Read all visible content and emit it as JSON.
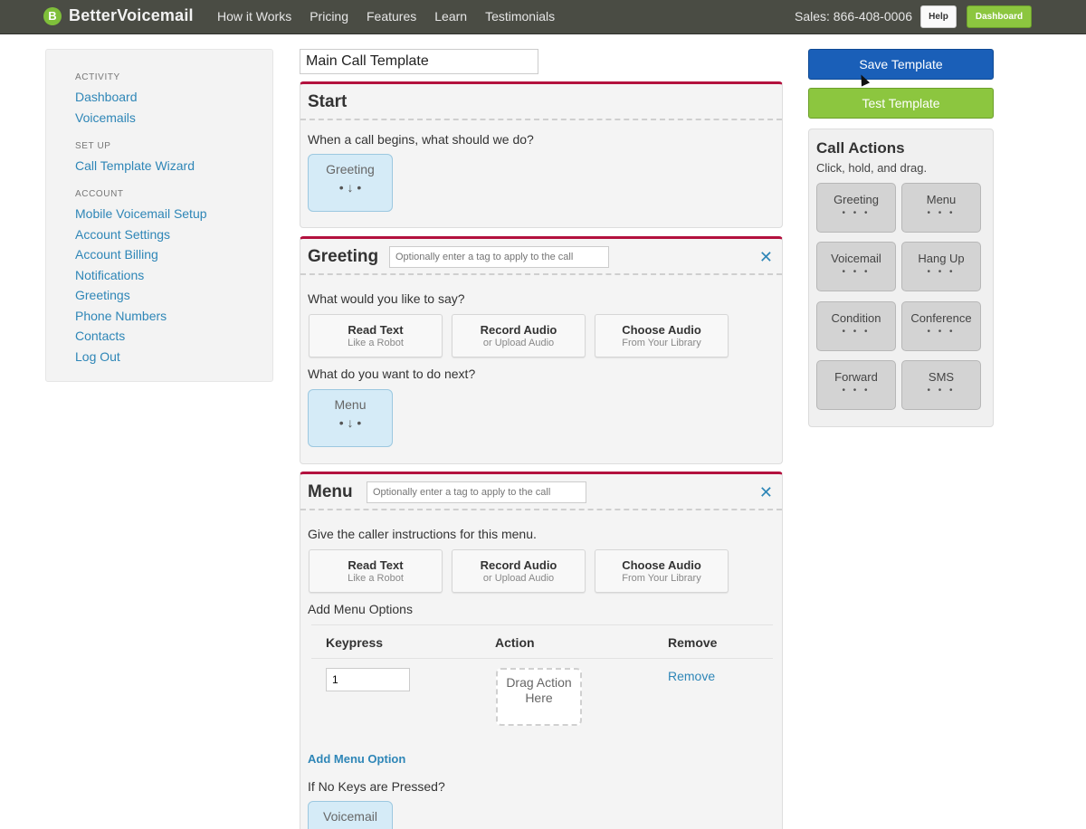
{
  "header": {
    "logo_glyph": "B",
    "brand": "BetterVoicemail",
    "nav": [
      "How it Works",
      "Pricing",
      "Features",
      "Learn",
      "Testimonials"
    ],
    "sales": "Sales: 866-408-0006",
    "help_label": "Help",
    "dashboard_label": "Dashboard"
  },
  "sidebar": {
    "sections": [
      {
        "heading": "ACTIVITY",
        "links": [
          "Dashboard",
          "Voicemails"
        ]
      },
      {
        "heading": "SET UP",
        "links": [
          "Call Template Wizard"
        ]
      },
      {
        "heading": "ACCOUNT",
        "links": [
          "Mobile Voicemail Setup",
          "Account Settings",
          "Account Billing",
          "Notifications",
          "Greetings",
          "Phone Numbers",
          "Contacts",
          "Log Out"
        ]
      }
    ]
  },
  "template_name": "Main Call Template",
  "start": {
    "title": "Start",
    "question": "When a call begins, what should we do?",
    "tile": "Greeting"
  },
  "greeting": {
    "title": "Greeting",
    "tag_placeholder": "Optionally enter a tag to apply to the call",
    "question": "What would you like to say?",
    "options": [
      {
        "title": "Read Text",
        "sub": "Like a Robot"
      },
      {
        "title": "Record Audio",
        "sub": "or Upload Audio"
      },
      {
        "title": "Choose Audio",
        "sub": "From Your Library"
      }
    ],
    "next_question": "What do you want to do next?",
    "next_tile": "Menu"
  },
  "menu": {
    "title": "Menu",
    "tag_placeholder": "Optionally enter a tag to apply to the call",
    "question": "Give the caller instructions for this menu.",
    "options": [
      {
        "title": "Read Text",
        "sub": "Like a Robot"
      },
      {
        "title": "Record Audio",
        "sub": "or Upload Audio"
      },
      {
        "title": "Choose Audio",
        "sub": "From Your Library"
      }
    ],
    "add_options_label": "Add Menu Options",
    "table_headers": [
      "Keypress",
      "Action",
      "Remove"
    ],
    "row": {
      "keypress": "1",
      "drag_text": "Drag Action Here",
      "remove": "Remove"
    },
    "add_option_link": "Add Menu Option",
    "no_keys_question": "If No Keys are Pressed?",
    "no_keys_tile": "Voicemail"
  },
  "right": {
    "save_label": "Save Template",
    "test_label": "Test Template",
    "actions_title": "Call Actions",
    "actions_subtitle": "Click, hold, and drag.",
    "actions": [
      "Greeting",
      "Menu",
      "Voicemail",
      "Hang Up",
      "Condition",
      "Conference",
      "Forward",
      "SMS"
    ]
  },
  "colors": {
    "topbar": "#4a4c44",
    "accent_red": "#b3113e",
    "link_blue": "#2e86b7",
    "save_blue": "#1a5fb8",
    "green": "#8cc63f"
  }
}
